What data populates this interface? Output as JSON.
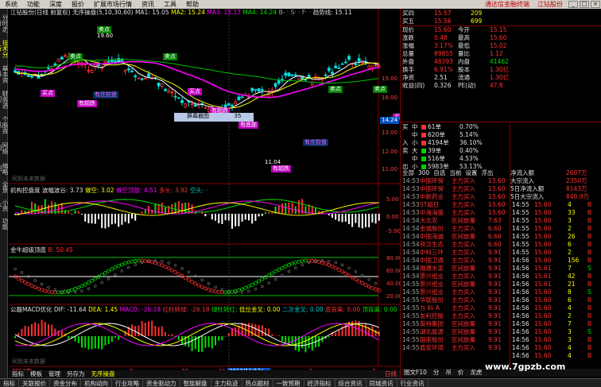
{
  "menubar": {
    "items": [
      "系统",
      "功能",
      "深度",
      "报价",
      "扩展市场行情",
      "资讯",
      "工具",
      "帮助"
    ],
    "ad": "通达信金融终端",
    "stock_title": "江钻股份"
  },
  "left_tabs": [
    "分时走势",
    "技术分析",
    "基本资料",
    "财务透视",
    "个股资讯",
    "网络图",
    "缩略图",
    "全景",
    "小资本",
    "功能"
  ],
  "main_chart": {
    "header": "江钻股份(日线 前复权)",
    "header2": "无序操盘(5,10,30,60)",
    "ma1": "MA1: 15.05",
    "ma2": "MA2: 15.24",
    "ma3": "MA3: 15.17",
    "ma4": "MA4: 14.24",
    "extra": "B- · S· · F· ·",
    "trend": "趋势线: 15.11",
    "price_labels": [
      "19.60",
      "16.00",
      "15.00",
      "14.00",
      "13.00",
      "12.00",
      "11.00"
    ],
    "last_price": "14.24",
    "tooltip": "屏幕截图",
    "tooltip_value": "35",
    "annotations": {
      "sell": "卖点",
      "buy": "买点",
      "hold": "有庄控盘",
      "rebound": "有超跌",
      "bottom": "有超跌",
      "bottom2": "有底部",
      "level": "15.40",
      "low": "11.04",
      "high": "19.60"
    },
    "watermark": "同到未来数据"
  },
  "panel2": {
    "title": "机构控盘度",
    "label1": "波幅波谷: 3.73",
    "label2": "做空: 3.02",
    "label3": "做空顶部: 4.51",
    "label4": "多头: 3.92",
    "label5": "空头: ·",
    "ticks": [
      "5.00",
      "0.00",
      "-5.00"
    ]
  },
  "panel3": {
    "title": "金牛超级顶底",
    "value": "B: 50.45",
    "ticks": [
      "80.00",
      "60.00",
      "40.00",
      "20.00"
    ]
  },
  "panel4": {
    "title": "公磊MACD优化",
    "dif": "DIF: -11.64",
    "dea": "DEA: 1.45",
    "macd": "MACD: -26.18",
    "l1": "红柱转绿: -26.18",
    "l2": "绿柱转红: ",
    "l3": "低位金叉: 0.00",
    "l4": "二次金叉: 0.00",
    "l5": "底背离: 0.00",
    "l6": "顶背离: 0.00",
    "watermark": "同到未来数据"
  },
  "time_axis": {
    "labels": [
      "2012年",
      "9",
      "10",
      "11",
      "12",
      "2012/11/12/一",
      "2",
      "3",
      "日线"
    ]
  },
  "chart_tabs": [
    "指标",
    "模板",
    "管理",
    "另存为",
    "无序操盘"
  ],
  "right": {
    "quote_top": [
      {
        "l": "买四",
        "v": "15.57",
        "v2": "209"
      },
      {
        "l": "买五",
        "v": "15.56",
        "v2": "699"
      }
    ],
    "stats": [
      {
        "l": "现价",
        "v": "15.60",
        "l2": "今开",
        "v2": "15.15"
      },
      {
        "l": "涨跌",
        "v": "0.48",
        "l2": "最高",
        "v2": "15.60"
      },
      {
        "l": "涨幅",
        "v": "3.17%",
        "l2": "最低",
        "v2": "15.02"
      },
      {
        "l": "总量",
        "v": "89855",
        "l2": "量比",
        "v2": "1.12"
      },
      {
        "l": "外盘",
        "v": "48393",
        "l2": "内盘",
        "v2": "41462"
      },
      {
        "l": "换手",
        "v": "6.91%",
        "l2": "股本",
        "v2": "1.30亿"
      },
      {
        "l": "净资",
        "v": "2.51",
        "l2": "流通",
        "v2": "1.30亿"
      },
      {
        "l": "收益(四)",
        "v": "0.326",
        "l2": "PE(动)",
        "v2": "47.8"
      }
    ],
    "bigorder": [
      {
        "side": "买",
        "t": "中",
        "c": "61单",
        "p": "0.70%"
      },
      {
        "side": "",
        "t": "中",
        "c": "620单",
        "p": "5.14%"
      },
      {
        "side": "入",
        "t": "小",
        "c": "4194单",
        "p": "36.10%"
      },
      {
        "side": "卖",
        "t": "大",
        "c": "39单",
        "p": "0.40%"
      },
      {
        "side": "",
        "t": "中",
        "c": "516单",
        "p": "4.53%"
      },
      {
        "side": "出",
        "t": "小",
        "c": "5983单",
        "p": "53.13%"
      }
    ],
    "tabs": [
      "全部",
      "300",
      "自选",
      "当前",
      "设置",
      "浮出"
    ],
    "summary": [
      {
        "l": "净流入额",
        "v": "2607万"
      },
      {
        "l": "大宗流入",
        "v": "2350万"
      },
      {
        "l": "5日净流入额",
        "v": "8143万"
      },
      {
        "l": "5日大宗流入",
        "v": "840.9万"
      }
    ],
    "news": [
      {
        "t": "14:53",
        "n": "中国环保",
        "s": "主力买入",
        "v": "13.60"
      },
      {
        "t": "14:53",
        "n": "中国环保",
        "s": "主力买入",
        "v": "13.60"
      },
      {
        "t": "14:53",
        "n": "中新药业",
        "s": "主力买入",
        "v": "13.60"
      },
      {
        "t": "14:53",
        "n": "ST超日",
        "s": "主力买入",
        "v": "13.60"
      },
      {
        "t": "14:53",
        "n": "中海海盛",
        "s": "主力买入",
        "v": "13.60"
      },
      {
        "t": "14:54",
        "n": "大北农",
        "s": "区间放量",
        "v": "7.63"
      },
      {
        "t": "14:54",
        "n": "金城股份",
        "s": "主力买入",
        "v": "6.60"
      },
      {
        "t": "14:54",
        "n": "中国海诚",
        "s": "区间放量",
        "v": "6.66"
      },
      {
        "t": "14:54",
        "n": "铁汉生态",
        "s": "主力买入",
        "v": "6.60"
      },
      {
        "t": "14:54",
        "n": "中科三环",
        "s": "主力买入",
        "v": "9.91"
      },
      {
        "t": "14:54",
        "n": "中国卫通",
        "s": "主力买入",
        "v": "9.91"
      },
      {
        "t": "14:54",
        "n": "福建水泥",
        "s": "区间放量",
        "v": "9.91"
      },
      {
        "t": "14:54",
        "n": "景兴纸业",
        "s": "主力买入",
        "v": "9.91"
      },
      {
        "t": "14:55",
        "n": "景兴纸业",
        "s": "区间放量",
        "v": "9.91"
      },
      {
        "t": "14:55",
        "n": "景兴纸业",
        "s": "主力买入",
        "v": "9.91"
      },
      {
        "t": "14:55",
        "n": "华联股份",
        "s": "主力买入",
        "v": "9.91"
      },
      {
        "t": "14:55",
        "n": "方 科 A",
        "s": "主力买入",
        "v": "9.91"
      },
      {
        "t": "14:55",
        "n": "友利控股",
        "s": "主力买入",
        "v": "9.91"
      },
      {
        "t": "14:55",
        "n": "英特集团",
        "s": "区间放量",
        "v": "9.91"
      },
      {
        "t": "14:55",
        "n": "湖北能源",
        "s": "区间放量",
        "v": "9.91"
      },
      {
        "t": "14:55",
        "n": "银座股份",
        "s": "区间放量",
        "v": "9.91"
      },
      {
        "t": "14:55",
        "n": "盾安环境",
        "s": "主力买入",
        "v": "9.91"
      }
    ],
    "ticks": [
      {
        "t": "14:55",
        "p": "15.60",
        "v": "4",
        "f": "B"
      },
      {
        "t": "14:55",
        "p": "15.60",
        "v": "33",
        "f": "B"
      },
      {
        "t": "14:55",
        "p": "15.60",
        "v": "3",
        "f": "B"
      },
      {
        "t": "14:55",
        "p": "15.60",
        "v": "2",
        "f": "B"
      },
      {
        "t": "14:55",
        "p": "15.60",
        "v": "26",
        "f": "B"
      },
      {
        "t": "14:55",
        "p": "15.60",
        "v": "6",
        "f": "B"
      },
      {
        "t": "14:55",
        "p": "15.60",
        "v": "2",
        "f": "B"
      },
      {
        "t": "14:56",
        "p": "15.60",
        "v": "156",
        "f": "B"
      },
      {
        "t": "14:56",
        "p": "15.61",
        "v": "7",
        "f": "S"
      },
      {
        "t": "14:56",
        "p": "15.61",
        "v": "42",
        "f": "B"
      },
      {
        "t": "14:56",
        "p": "15.61",
        "v": "21",
        "f": "B"
      },
      {
        "t": "14:56",
        "p": "15.60",
        "v": "8",
        "f": "S"
      },
      {
        "t": "14:56",
        "p": "15.60",
        "v": "6",
        "f": "B"
      },
      {
        "t": "14:56",
        "p": "15.60",
        "v": "4",
        "f": "B"
      },
      {
        "t": "14:56",
        "p": "15.60",
        "v": "2",
        "f": "B"
      },
      {
        "t": "14:56",
        "p": "15.60",
        "v": "7",
        "f": "B"
      },
      {
        "t": "14:56",
        "p": "15.60",
        "v": "3",
        "f": "S"
      },
      {
        "t": "14:56",
        "p": "15.60",
        "v": "3",
        "f": "B"
      },
      {
        "t": "14:56",
        "p": "15.60",
        "v": "4",
        "f": "B"
      },
      {
        "t": "14:56",
        "p": "15.60",
        "v": "4",
        "f": "B"
      },
      {
        "t": "14:56",
        "p": "15.60",
        "v": "4",
        "f": "B"
      },
      {
        "t": "14:56",
        "p": "15.60",
        "v": "4",
        "f": "B"
      }
    ],
    "bottom_tabs": [
      "图文F10",
      "分",
      "吊",
      "价",
      "龙虎"
    ]
  },
  "bottombar": [
    "指标",
    "关联报价",
    "资金分布",
    "机构动向",
    "行业攻略",
    "资金驱动力",
    "智能解盘",
    "主力轨迹",
    "热点题材",
    "一致预期",
    "经济指标",
    "综合资讯",
    "同城资讯",
    "行业资讯"
  ],
  "watermark_url": "www.7gpzb.com",
  "colors": {
    "up": "#ff3030",
    "down": "#00e000",
    "accent": "#ffff00"
  }
}
